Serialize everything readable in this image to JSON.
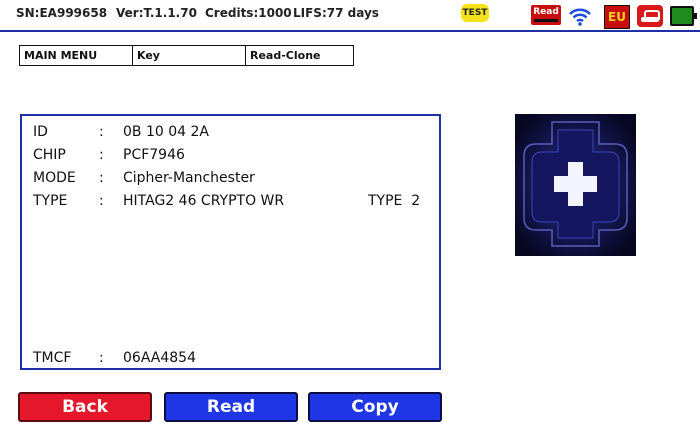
{
  "status": {
    "serial": "SN:EA999658",
    "version": "Ver:T.1.1.70",
    "credits": "Credits:1000",
    "lifs": "LIFS:77 days",
    "test_badge": "TEST",
    "read_icon_label": "Read",
    "region": "EU",
    "icons": [
      "read-icon",
      "wifi-icon",
      "eu-region-icon",
      "car-icon",
      "battery-icon"
    ],
    "battery_color": "#1f8a1f"
  },
  "breadcrumb": [
    "MAIN MENU",
    "Key",
    "Read-Clone"
  ],
  "info": {
    "rows": [
      {
        "key": "ID",
        "sep": ":",
        "value": "0B 10 04 2A"
      },
      {
        "key": "CHIP",
        "sep": ":",
        "value": "PCF7946"
      },
      {
        "key": "MODE",
        "sep": ":",
        "value": "Cipher-Manchester"
      },
      {
        "key": "TYPE",
        "sep": ":",
        "value": "HITAG2 46 CRYPTO WR",
        "extra": "TYPE  2"
      }
    ],
    "tmcf": {
      "key": "TMCF",
      "sep": ":",
      "value": "06AA4854"
    }
  },
  "buttons": {
    "back": "Back",
    "read": "Read",
    "copy": "Copy"
  },
  "colors": {
    "accent": "#1f2fa8",
    "back_button": "#e5172a",
    "action_button": "#1f36e4"
  }
}
